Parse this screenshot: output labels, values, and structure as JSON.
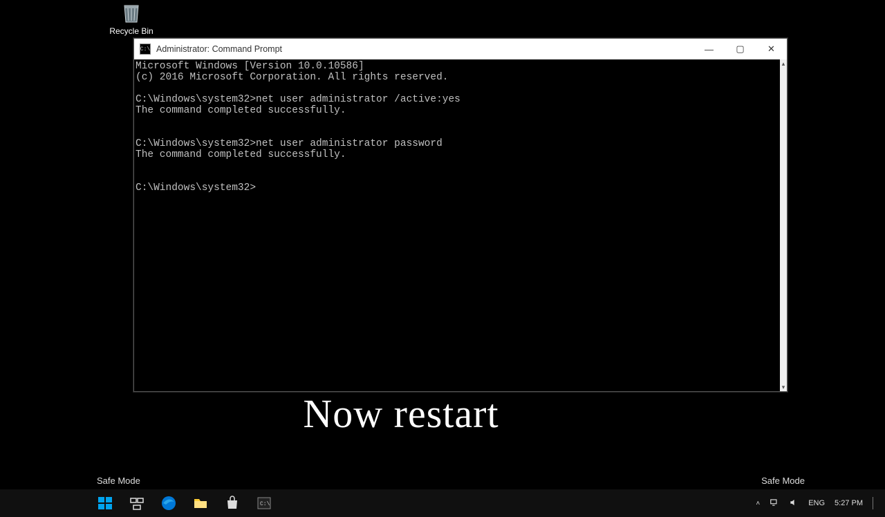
{
  "desktop": {
    "recycle_bin_label": "Recycle Bin"
  },
  "window": {
    "title": "Administrator: Command Prompt",
    "app_icon_text": "C:\\",
    "controls": {
      "min": "—",
      "max": "▢",
      "close": "✕"
    },
    "terminal_text": "Microsoft Windows [Version 10.0.10586]\n(c) 2016 Microsoft Corporation. All rights reserved.\n\nC:\\Windows\\system32>net user administrator /active:yes\nThe command completed successfully.\n\n\nC:\\Windows\\system32>net user administrator password\nThe command completed successfully.\n\n\nC:\\Windows\\system32>"
  },
  "caption": "Now restart",
  "safemode_label": "Safe Mode",
  "taskbar": {
    "lang": "ENG",
    "time": "5:27 PM"
  }
}
